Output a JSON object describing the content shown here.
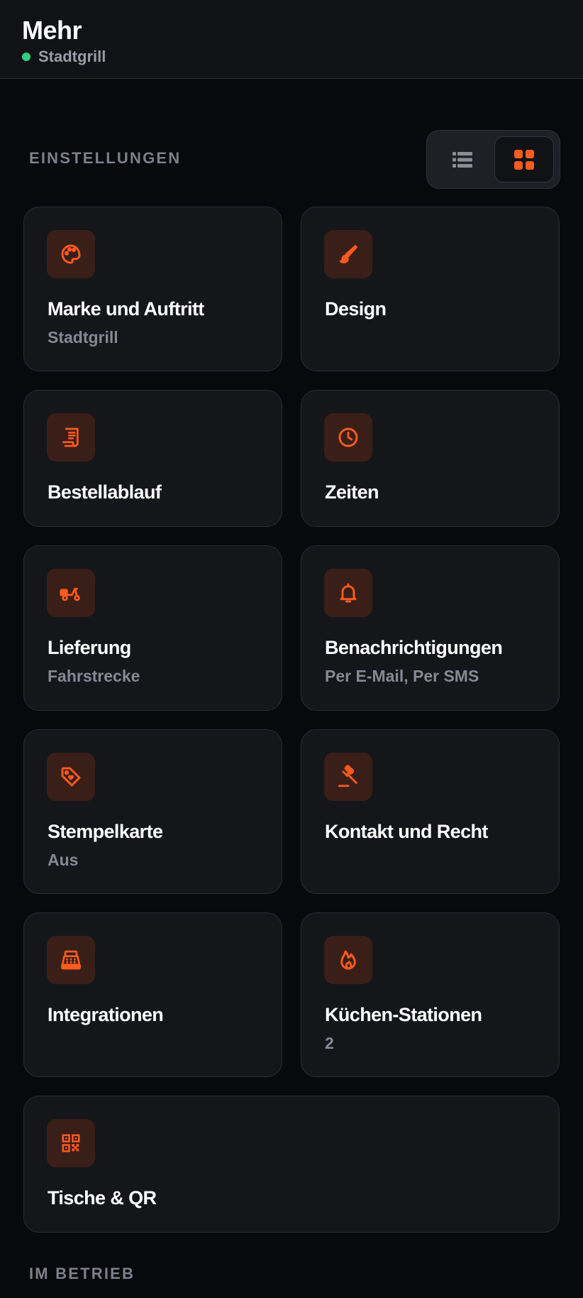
{
  "header": {
    "title": "Mehr",
    "restaurant": "Stadtgrill",
    "status_color": "#2fd07f"
  },
  "sections": {
    "settings_label": "EINSTELLUNGEN",
    "operations_label": "IM BETRIEB"
  },
  "view_toggle": {
    "options": [
      "list-icon",
      "grid-icon"
    ],
    "active": "grid"
  },
  "accent_color": "#ff5a1f",
  "cards": [
    {
      "title": "Marke und Auftritt",
      "subtitle": "Stadtgrill",
      "icon": "palette-icon"
    },
    {
      "title": "Design",
      "subtitle": "",
      "icon": "brush-icon"
    },
    {
      "title": "Bestellablauf",
      "subtitle": "",
      "icon": "receipt-icon"
    },
    {
      "title": "Zeiten",
      "subtitle": "",
      "icon": "clock-icon"
    },
    {
      "title": "Lieferung",
      "subtitle": "Fahrstrecke",
      "icon": "scooter-icon"
    },
    {
      "title": "Benachrichtigungen",
      "subtitle": "Per E-Mail, Per SMS",
      "icon": "bell-icon"
    },
    {
      "title": "Stempelkarte",
      "subtitle": "Aus",
      "icon": "tag-heart-icon"
    },
    {
      "title": "Kontakt und Recht",
      "subtitle": "",
      "icon": "gavel-icon"
    },
    {
      "title": "Integrationen",
      "subtitle": "",
      "icon": "cash-register-icon"
    },
    {
      "title": "Küchen-Stationen",
      "subtitle": "2",
      "icon": "flame-icon"
    },
    {
      "title": "Tische & QR",
      "subtitle": "",
      "icon": "qr-code-icon"
    }
  ]
}
